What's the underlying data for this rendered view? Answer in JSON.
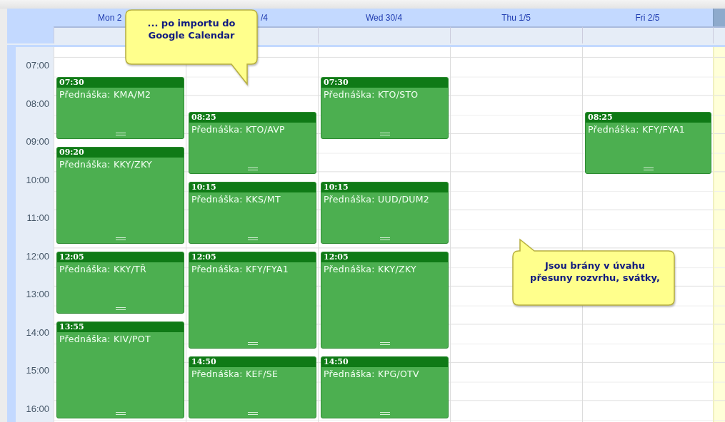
{
  "days": [
    {
      "label": "Mon 2",
      "events": [
        {
          "time": "07:30",
          "title": "Přednáška: KMA/M2",
          "kind": "single"
        },
        {
          "time": "09:20",
          "title": "Přednáška: KKY/ZKY",
          "kind": "double"
        },
        {
          "time": "12:05",
          "title": "Přednáška: KKY/TŘ",
          "kind": "single"
        },
        {
          "time": "13:55",
          "title": "Přednáška: KIV/POT",
          "kind": "double"
        }
      ]
    },
    {
      "label": "/4",
      "events": [
        {
          "time": "08:25",
          "title": "Přednáška: KTO/AVP",
          "kind": "single"
        },
        {
          "time": "10:15",
          "title": "Přednáška: KKS/MT",
          "kind": "single"
        },
        {
          "time": "12:05",
          "title": "Přednáška: KFY/FYA1",
          "kind": "double"
        },
        {
          "time": "14:50",
          "title": "Přednáška: KEF/SE",
          "kind": "single"
        }
      ]
    },
    {
      "label": "Wed 30/4",
      "events": [
        {
          "time": "07:30",
          "title": "Přednáška: KTO/STO",
          "kind": "single"
        },
        {
          "time": "10:15",
          "title": "Přednáška: UUD/DUM2",
          "kind": "single"
        },
        {
          "time": "12:05",
          "title": "Přednáška: KKY/ZKY",
          "kind": "double"
        },
        {
          "time": "14:50",
          "title": "Přednáška: KPG/OTV",
          "kind": "single"
        }
      ]
    },
    {
      "label": "Thu 1/5"
    },
    {
      "label": "Fri 2/5",
      "events": [
        {
          "time": "08:25",
          "title": "Přednáška: KFY/FYA1",
          "kind": "single"
        }
      ]
    }
  ],
  "hours": [
    "07:00",
    "08:00",
    "09:00",
    "10:00",
    "11:00",
    "12:00",
    "13:00",
    "14:00",
    "15:00",
    "16:00"
  ],
  "callouts": [
    {
      "text": "... po importu do Google Calendar",
      "kind": "tail-down"
    },
    {
      "text": "Jsou brány v úvahu přesuny rozvrhu, svátky,",
      "kind": "tail-up"
    }
  ]
}
